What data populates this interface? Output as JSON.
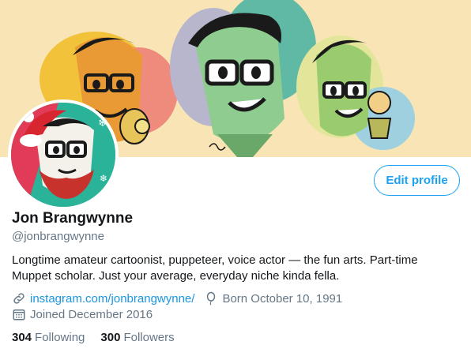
{
  "profile": {
    "name": "Jon Brangwynne",
    "handle": "@jonbrangwynne",
    "bio": "Longtime amateur cartoonist, puppeteer, voice actor — the fun arts. Part-time Muppet scholar. Just your average, everyday niche kinda fella.",
    "website": "instagram.com/jonbrangwynne/",
    "birth": "Born October 10, 1991",
    "joined": "Joined December 2016"
  },
  "actions": {
    "edit_profile": "Edit profile"
  },
  "stats": {
    "following_count": "304",
    "following_label": "Following",
    "followers_count": "300",
    "followers_label": "Followers"
  },
  "icons": {
    "link": "link-icon",
    "birth": "balloon-icon",
    "joined": "calendar-icon"
  },
  "colors": {
    "accent": "#1da1f2",
    "link": "#1b95e0",
    "secondary_text": "#657786",
    "primary_text": "#14171a",
    "banner_bg": "#f7e3b2"
  }
}
